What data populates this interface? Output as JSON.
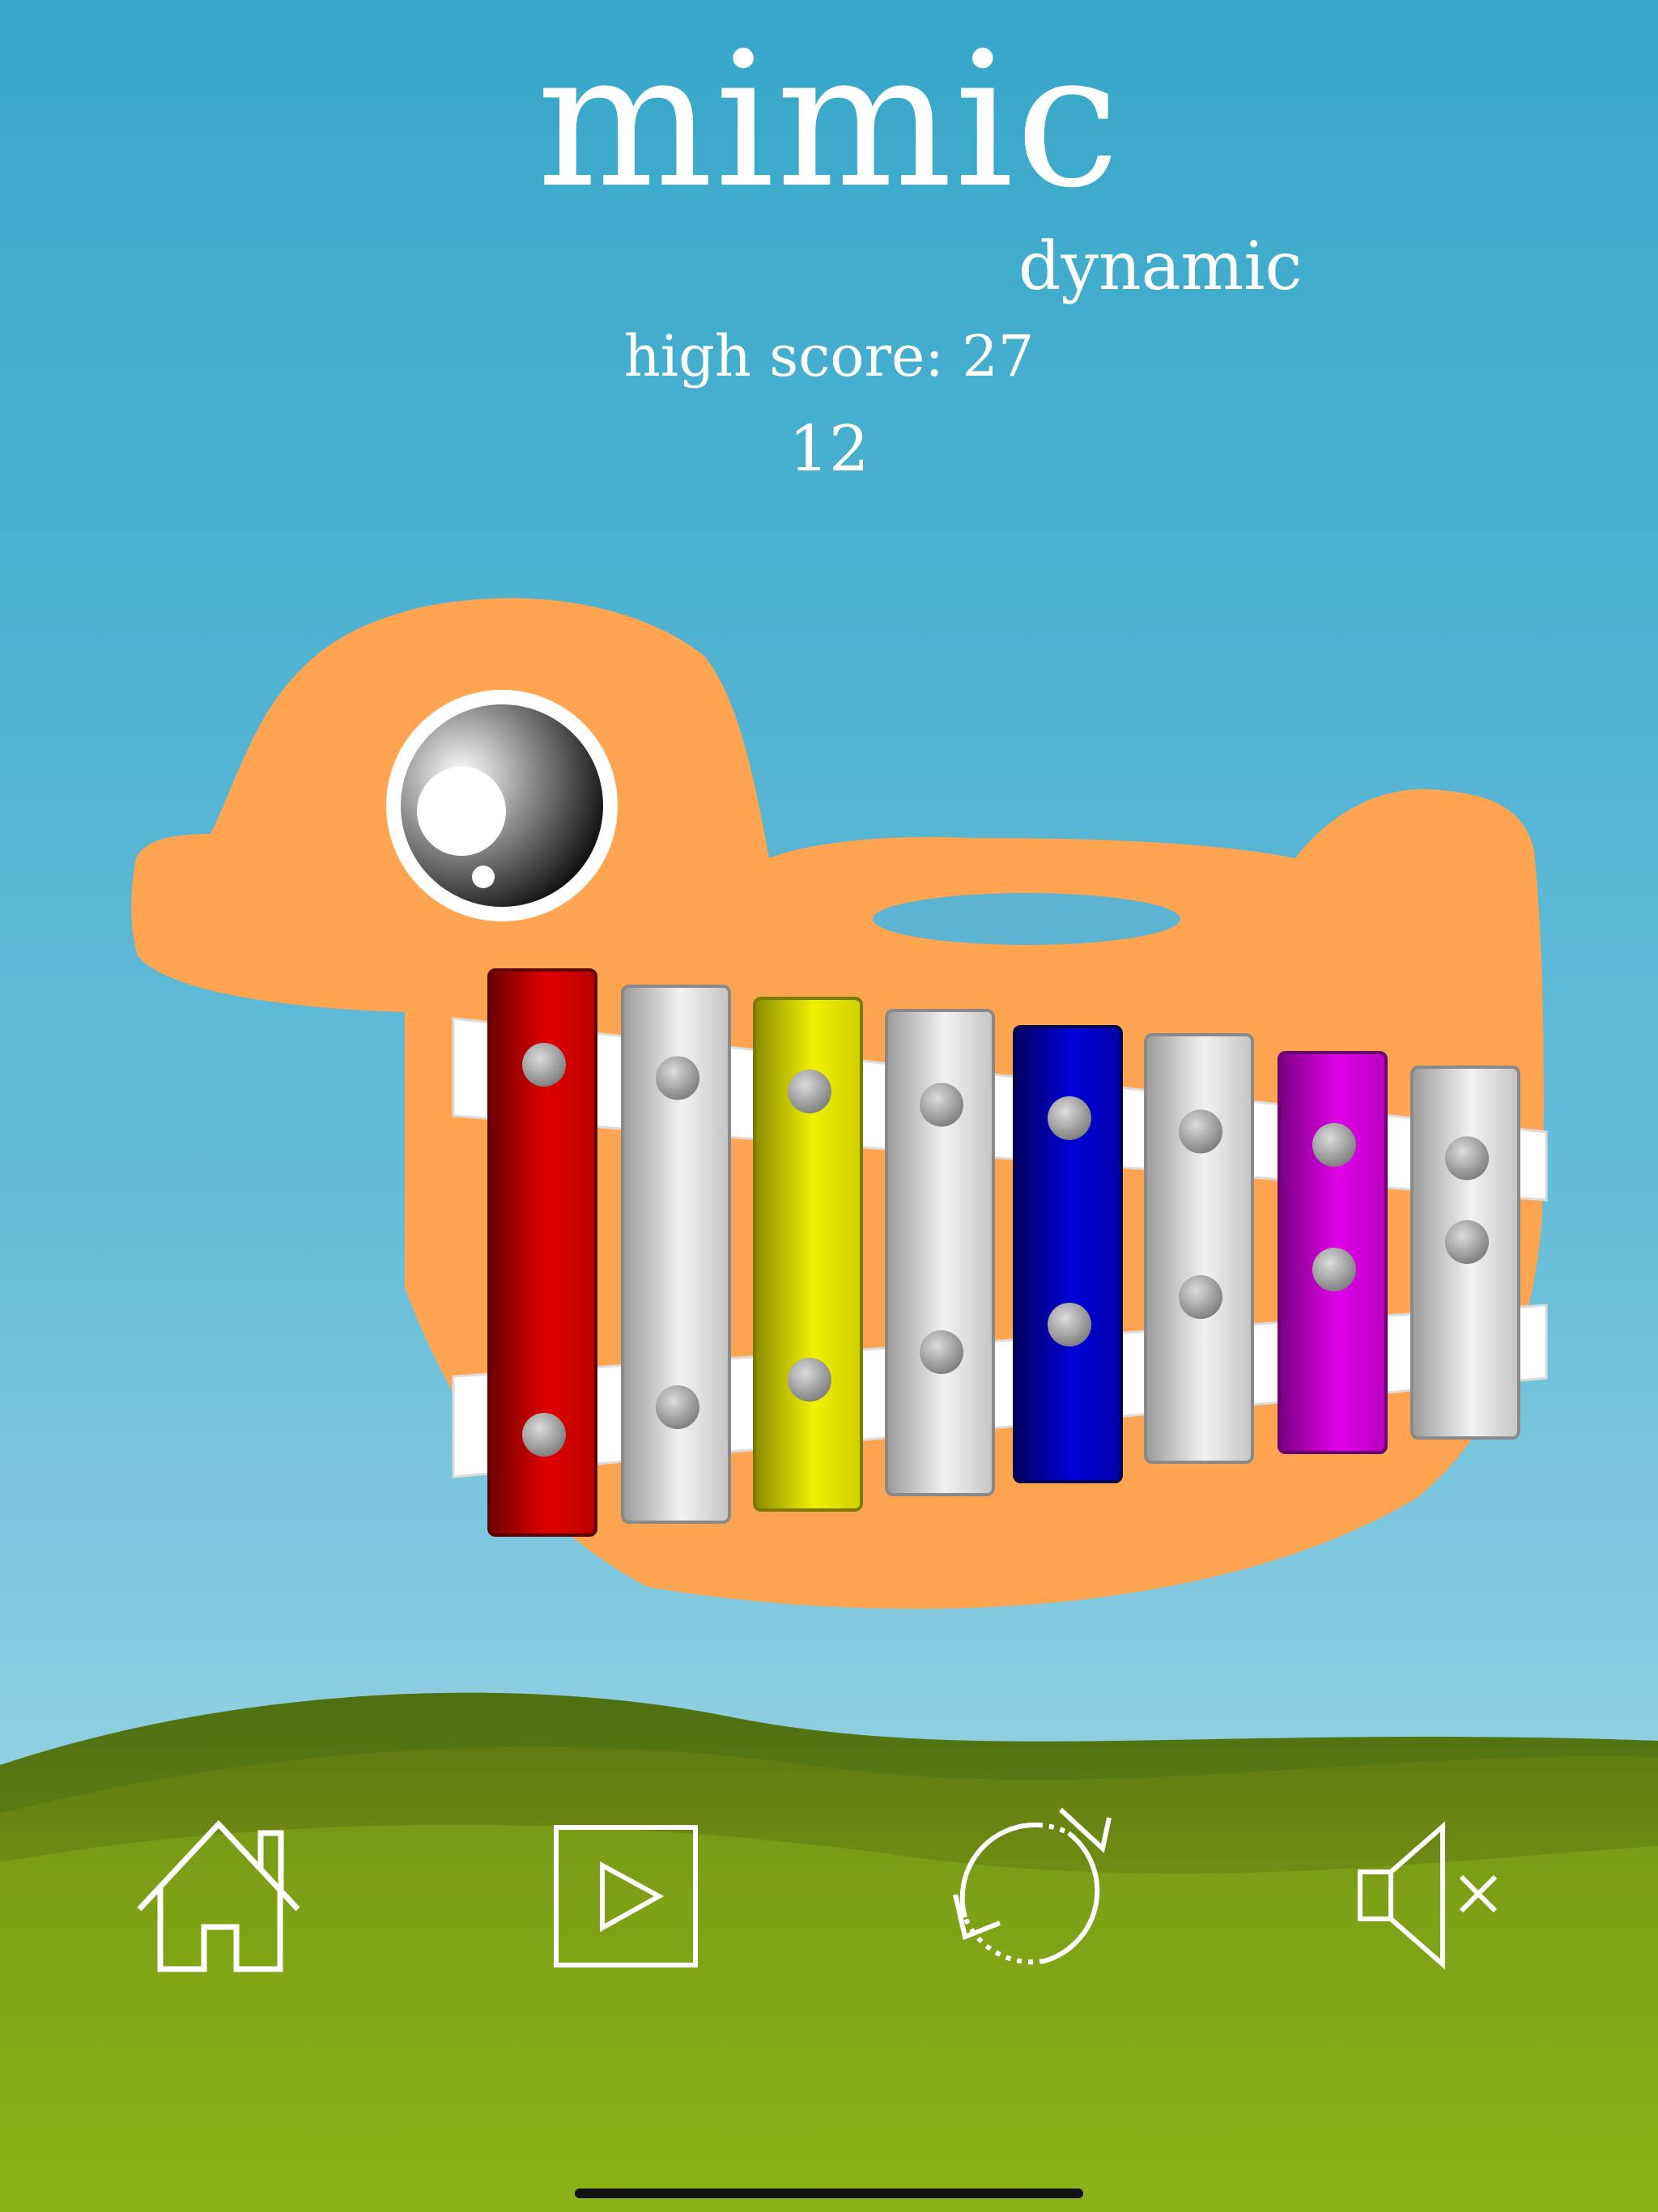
{
  "game": {
    "title": "mimic",
    "mode": "dynamic",
    "high_score_text": "high score: 27",
    "score": "12"
  },
  "colors": {
    "sky_top": "#37a7c9",
    "sky_bottom": "#a9d9e6",
    "duck": "#ffa450",
    "hill_dark": "#5f7d14",
    "hill_light": "#8cb51a"
  },
  "xylophone": {
    "keys": [
      {
        "color": "red",
        "state": "lit"
      },
      {
        "color": "silver",
        "state": "unlit"
      },
      {
        "color": "yellow",
        "state": "lit"
      },
      {
        "color": "silver",
        "state": "unlit"
      },
      {
        "color": "blue",
        "state": "lit"
      },
      {
        "color": "silver",
        "state": "unlit"
      },
      {
        "color": "magenta",
        "state": "lit"
      },
      {
        "color": "silver",
        "state": "unlit"
      }
    ]
  },
  "toolbar": [
    {
      "icon": "home-icon"
    },
    {
      "icon": "play-icon"
    },
    {
      "icon": "replay-icon"
    },
    {
      "icon": "mute-icon"
    }
  ]
}
